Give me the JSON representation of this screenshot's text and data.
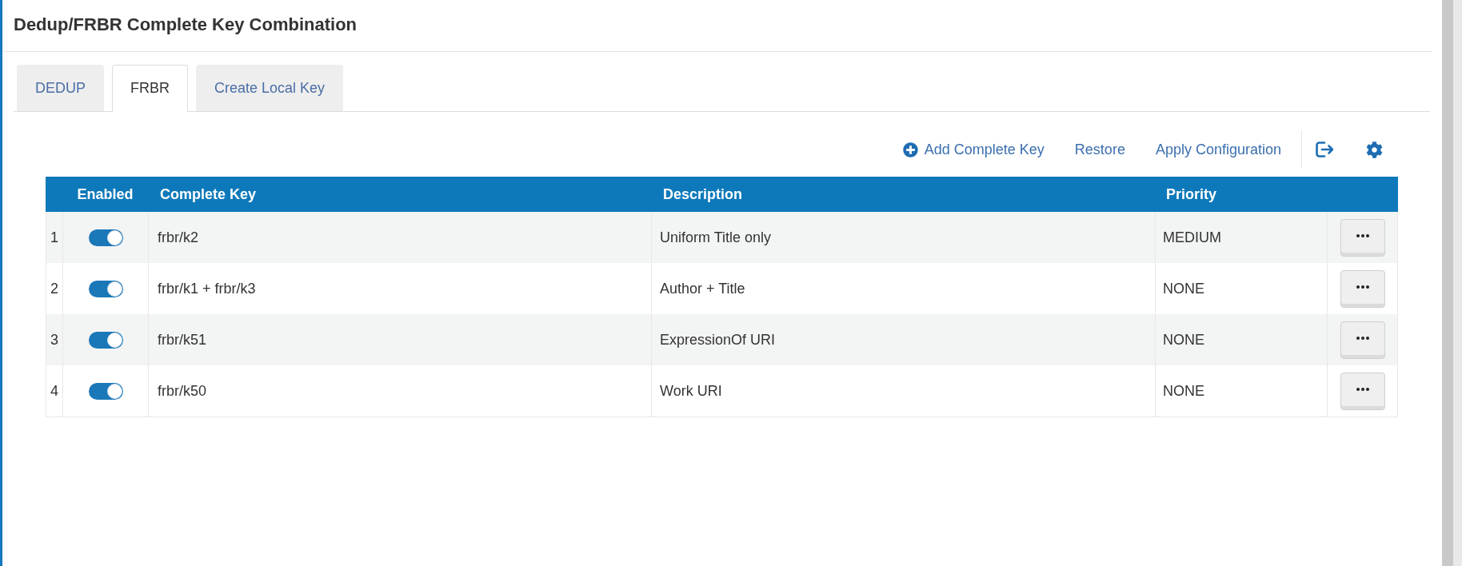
{
  "page_title": "Dedup/FRBR Complete Key Combination",
  "tabs": [
    {
      "label": "DEDUP",
      "selected": false
    },
    {
      "label": "FRBR",
      "selected": true
    },
    {
      "label": "Create Local Key",
      "selected": false
    }
  ],
  "toolbar": [
    {
      "kind": "add",
      "label": "Add Complete Key"
    },
    {
      "kind": "link",
      "label": "Restore"
    },
    {
      "kind": "link",
      "label": "Apply Configuration"
    }
  ],
  "table": {
    "columns": [
      "Enabled",
      "Complete Key",
      "Description",
      "Priority"
    ],
    "rows": [
      {
        "number": "1",
        "enabled": true,
        "complete_key": "frbr/k2",
        "description": "Uniform Title only",
        "priority": "MEDIUM"
      },
      {
        "number": "2",
        "enabled": true,
        "complete_key": "frbr/k1 + frbr/k3",
        "description": "Author + Title",
        "priority": "NONE"
      },
      {
        "number": "3",
        "enabled": true,
        "complete_key": "frbr/k51",
        "description": "ExpressionOf URI",
        "priority": "NONE"
      },
      {
        "number": "4",
        "enabled": true,
        "complete_key": "frbr/k50",
        "description": "Work URI",
        "priority": "NONE"
      }
    ]
  }
}
